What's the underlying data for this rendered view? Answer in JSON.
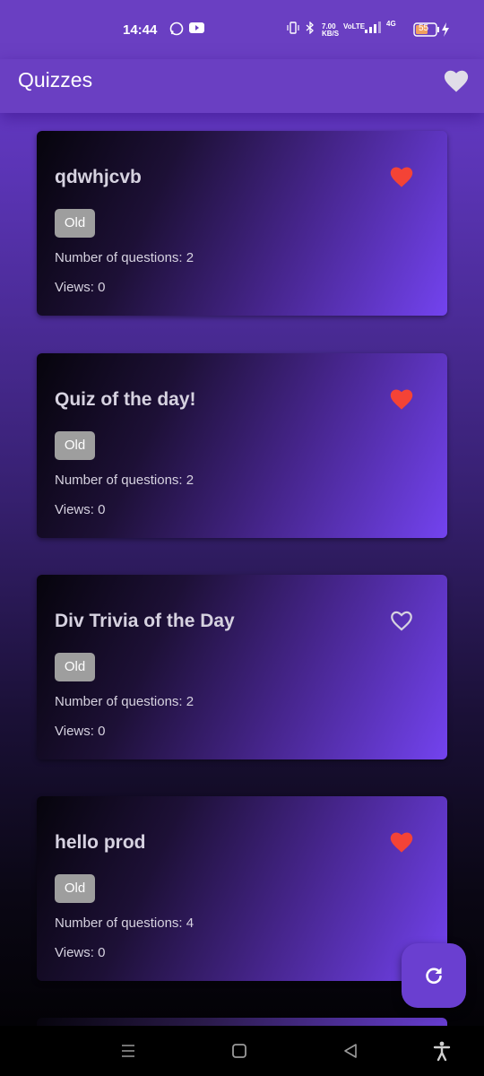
{
  "status": {
    "time": "14:44",
    "net_speed": "7.00 KB/S",
    "network": "4G",
    "battery": "55",
    "icons": [
      "whatsapp-icon",
      "youtube-icon",
      "vibrate-icon",
      "bluetooth-icon",
      "volte-icon",
      "signal-icon",
      "battery-icon",
      "charging-icon"
    ]
  },
  "appbar": {
    "title": "Quizzes"
  },
  "labels": {
    "questions_prefix": "Number of questions: ",
    "views_prefix": "Views: "
  },
  "quizzes": [
    {
      "title": "qdwhjcvb",
      "badge": "Old",
      "questions": "Number of questions: 2",
      "views": "Views: 0",
      "favorite": true
    },
    {
      "title": "Quiz of the day!",
      "badge": "Old",
      "questions": "Number of questions: 2",
      "views": "Views: 0",
      "favorite": true
    },
    {
      "title": "Div Trivia of the Day",
      "badge": "Old",
      "questions": "Number of questions: 2",
      "views": "Views: 0",
      "favorite": false
    },
    {
      "title": "hello prod",
      "badge": "Old",
      "questions": "Number of questions: 4",
      "views": "Views: 0",
      "favorite": true
    }
  ],
  "colors": {
    "accent": "#6a3fc2",
    "heart_active": "#f44336",
    "heart_inactive": "#d6d2e0",
    "badge": "#9e9e9e"
  }
}
